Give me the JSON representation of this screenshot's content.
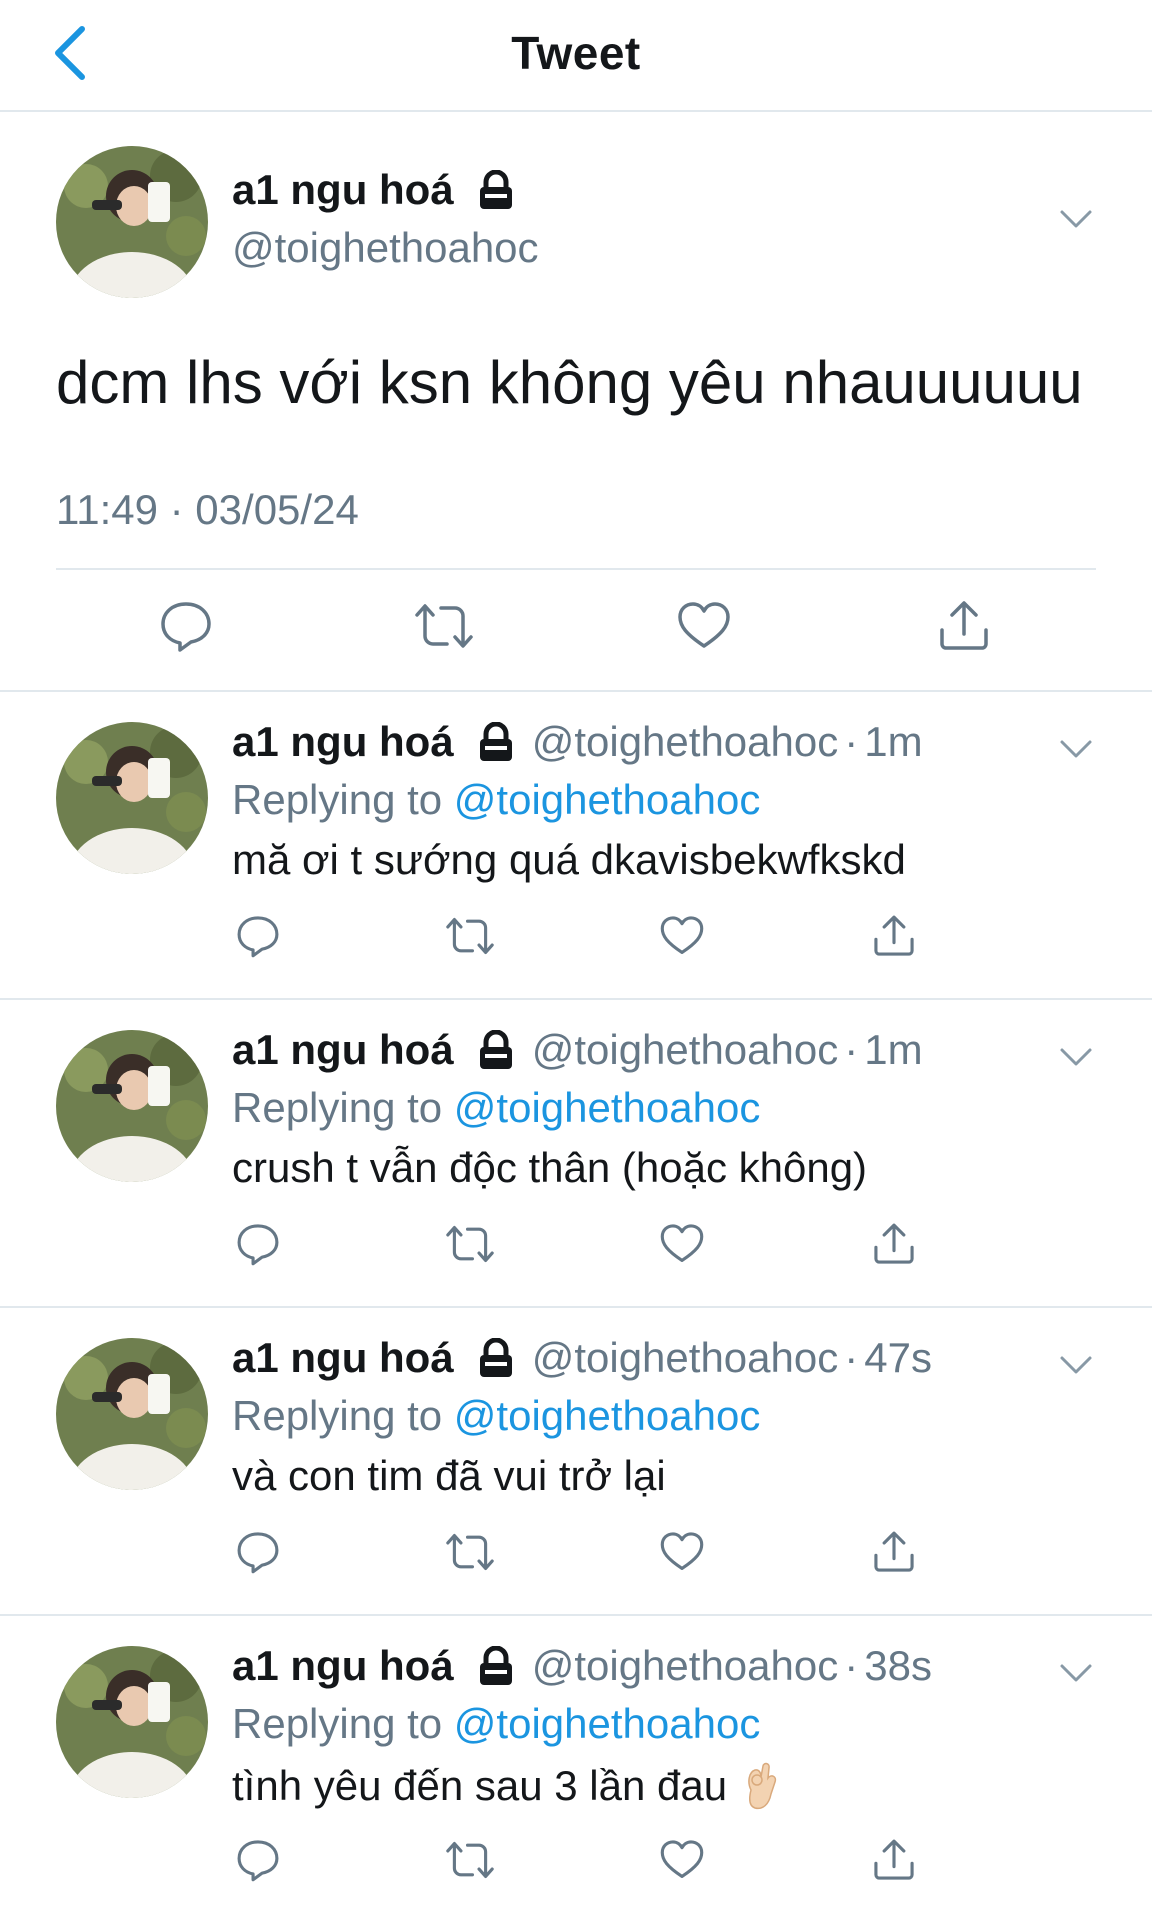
{
  "header": {
    "title": "Tweet",
    "back_icon": "chevron-left-icon"
  },
  "colors": {
    "accent": "#1b95e0",
    "secondary_text": "#657786",
    "divider": "#e1e8ed"
  },
  "main_tweet": {
    "name": "a1 ngu hoá",
    "handle": "@toighethoahoc",
    "text": "dcm lhs với ksn không yêu nhauuuuuu",
    "timestamp": "11:49 · 03/05/24"
  },
  "replies": [
    {
      "name": "a1 ngu hoá",
      "handle": "@toighethoahoc",
      "dot": "·",
      "time": "1m",
      "replying_prefix": "Replying to",
      "replying_to": "@toighethoahoc",
      "text": "mă ơi t sướng quá dkavisbekwfkskd",
      "emoji": ""
    },
    {
      "name": "a1 ngu hoá",
      "handle": "@toighethoahoc",
      "dot": "·",
      "time": "1m",
      "replying_prefix": "Replying to",
      "replying_to": "@toighethoahoc",
      "text": "crush t vẫn độc thân (hoặc không)",
      "emoji": ""
    },
    {
      "name": "a1 ngu hoá",
      "handle": "@toighethoahoc",
      "dot": "·",
      "time": "47s",
      "replying_prefix": "Replying to",
      "replying_to": "@toighethoahoc",
      "text": "và con tim đã vui trở lại",
      "emoji": ""
    },
    {
      "name": "a1 ngu hoá",
      "handle": "@toighethoahoc",
      "dot": "·",
      "time": "38s",
      "replying_prefix": "Replying to",
      "replying_to": "@toighethoahoc",
      "text": "tình yêu đến sau 3 lần đau",
      "emoji": "ok-hand-emoji"
    }
  ]
}
